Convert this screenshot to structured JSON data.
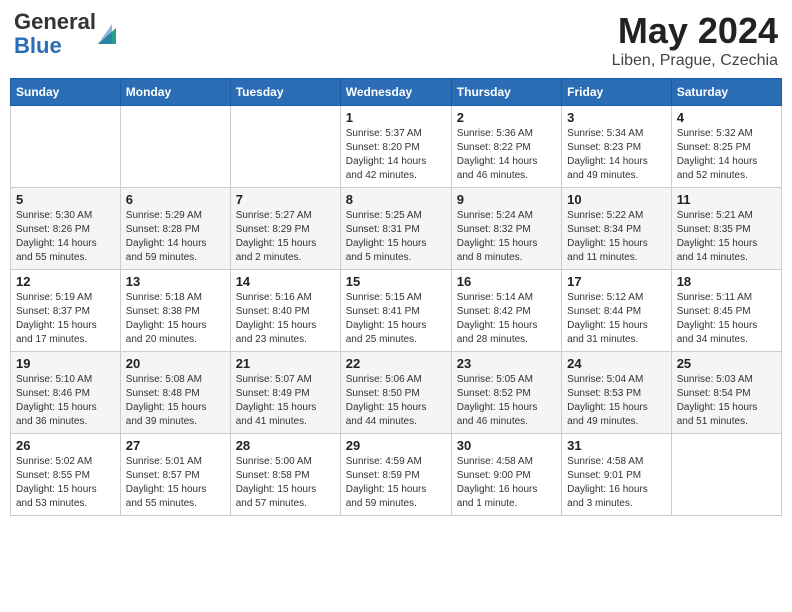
{
  "header": {
    "logo_general": "General",
    "logo_blue": "Blue",
    "title": "May 2024",
    "location": "Liben, Prague, Czechia"
  },
  "weekdays": [
    "Sunday",
    "Monday",
    "Tuesday",
    "Wednesday",
    "Thursday",
    "Friday",
    "Saturday"
  ],
  "weeks": [
    [
      {
        "day": "",
        "sunrise": "",
        "sunset": "",
        "daylight": ""
      },
      {
        "day": "",
        "sunrise": "",
        "sunset": "",
        "daylight": ""
      },
      {
        "day": "",
        "sunrise": "",
        "sunset": "",
        "daylight": ""
      },
      {
        "day": "1",
        "sunrise": "Sunrise: 5:37 AM",
        "sunset": "Sunset: 8:20 PM",
        "daylight": "Daylight: 14 hours and 42 minutes."
      },
      {
        "day": "2",
        "sunrise": "Sunrise: 5:36 AM",
        "sunset": "Sunset: 8:22 PM",
        "daylight": "Daylight: 14 hours and 46 minutes."
      },
      {
        "day": "3",
        "sunrise": "Sunrise: 5:34 AM",
        "sunset": "Sunset: 8:23 PM",
        "daylight": "Daylight: 14 hours and 49 minutes."
      },
      {
        "day": "4",
        "sunrise": "Sunrise: 5:32 AM",
        "sunset": "Sunset: 8:25 PM",
        "daylight": "Daylight: 14 hours and 52 minutes."
      }
    ],
    [
      {
        "day": "5",
        "sunrise": "Sunrise: 5:30 AM",
        "sunset": "Sunset: 8:26 PM",
        "daylight": "Daylight: 14 hours and 55 minutes."
      },
      {
        "day": "6",
        "sunrise": "Sunrise: 5:29 AM",
        "sunset": "Sunset: 8:28 PM",
        "daylight": "Daylight: 14 hours and 59 minutes."
      },
      {
        "day": "7",
        "sunrise": "Sunrise: 5:27 AM",
        "sunset": "Sunset: 8:29 PM",
        "daylight": "Daylight: 15 hours and 2 minutes."
      },
      {
        "day": "8",
        "sunrise": "Sunrise: 5:25 AM",
        "sunset": "Sunset: 8:31 PM",
        "daylight": "Daylight: 15 hours and 5 minutes."
      },
      {
        "day": "9",
        "sunrise": "Sunrise: 5:24 AM",
        "sunset": "Sunset: 8:32 PM",
        "daylight": "Daylight: 15 hours and 8 minutes."
      },
      {
        "day": "10",
        "sunrise": "Sunrise: 5:22 AM",
        "sunset": "Sunset: 8:34 PM",
        "daylight": "Daylight: 15 hours and 11 minutes."
      },
      {
        "day": "11",
        "sunrise": "Sunrise: 5:21 AM",
        "sunset": "Sunset: 8:35 PM",
        "daylight": "Daylight: 15 hours and 14 minutes."
      }
    ],
    [
      {
        "day": "12",
        "sunrise": "Sunrise: 5:19 AM",
        "sunset": "Sunset: 8:37 PM",
        "daylight": "Daylight: 15 hours and 17 minutes."
      },
      {
        "day": "13",
        "sunrise": "Sunrise: 5:18 AM",
        "sunset": "Sunset: 8:38 PM",
        "daylight": "Daylight: 15 hours and 20 minutes."
      },
      {
        "day": "14",
        "sunrise": "Sunrise: 5:16 AM",
        "sunset": "Sunset: 8:40 PM",
        "daylight": "Daylight: 15 hours and 23 minutes."
      },
      {
        "day": "15",
        "sunrise": "Sunrise: 5:15 AM",
        "sunset": "Sunset: 8:41 PM",
        "daylight": "Daylight: 15 hours and 25 minutes."
      },
      {
        "day": "16",
        "sunrise": "Sunrise: 5:14 AM",
        "sunset": "Sunset: 8:42 PM",
        "daylight": "Daylight: 15 hours and 28 minutes."
      },
      {
        "day": "17",
        "sunrise": "Sunrise: 5:12 AM",
        "sunset": "Sunset: 8:44 PM",
        "daylight": "Daylight: 15 hours and 31 minutes."
      },
      {
        "day": "18",
        "sunrise": "Sunrise: 5:11 AM",
        "sunset": "Sunset: 8:45 PM",
        "daylight": "Daylight: 15 hours and 34 minutes."
      }
    ],
    [
      {
        "day": "19",
        "sunrise": "Sunrise: 5:10 AM",
        "sunset": "Sunset: 8:46 PM",
        "daylight": "Daylight: 15 hours and 36 minutes."
      },
      {
        "day": "20",
        "sunrise": "Sunrise: 5:08 AM",
        "sunset": "Sunset: 8:48 PM",
        "daylight": "Daylight: 15 hours and 39 minutes."
      },
      {
        "day": "21",
        "sunrise": "Sunrise: 5:07 AM",
        "sunset": "Sunset: 8:49 PM",
        "daylight": "Daylight: 15 hours and 41 minutes."
      },
      {
        "day": "22",
        "sunrise": "Sunrise: 5:06 AM",
        "sunset": "Sunset: 8:50 PM",
        "daylight": "Daylight: 15 hours and 44 minutes."
      },
      {
        "day": "23",
        "sunrise": "Sunrise: 5:05 AM",
        "sunset": "Sunset: 8:52 PM",
        "daylight": "Daylight: 15 hours and 46 minutes."
      },
      {
        "day": "24",
        "sunrise": "Sunrise: 5:04 AM",
        "sunset": "Sunset: 8:53 PM",
        "daylight": "Daylight: 15 hours and 49 minutes."
      },
      {
        "day": "25",
        "sunrise": "Sunrise: 5:03 AM",
        "sunset": "Sunset: 8:54 PM",
        "daylight": "Daylight: 15 hours and 51 minutes."
      }
    ],
    [
      {
        "day": "26",
        "sunrise": "Sunrise: 5:02 AM",
        "sunset": "Sunset: 8:55 PM",
        "daylight": "Daylight: 15 hours and 53 minutes."
      },
      {
        "day": "27",
        "sunrise": "Sunrise: 5:01 AM",
        "sunset": "Sunset: 8:57 PM",
        "daylight": "Daylight: 15 hours and 55 minutes."
      },
      {
        "day": "28",
        "sunrise": "Sunrise: 5:00 AM",
        "sunset": "Sunset: 8:58 PM",
        "daylight": "Daylight: 15 hours and 57 minutes."
      },
      {
        "day": "29",
        "sunrise": "Sunrise: 4:59 AM",
        "sunset": "Sunset: 8:59 PM",
        "daylight": "Daylight: 15 hours and 59 minutes."
      },
      {
        "day": "30",
        "sunrise": "Sunrise: 4:58 AM",
        "sunset": "Sunset: 9:00 PM",
        "daylight": "Daylight: 16 hours and 1 minute."
      },
      {
        "day": "31",
        "sunrise": "Sunrise: 4:58 AM",
        "sunset": "Sunset: 9:01 PM",
        "daylight": "Daylight: 16 hours and 3 minutes."
      },
      {
        "day": "",
        "sunrise": "",
        "sunset": "",
        "daylight": ""
      }
    ]
  ]
}
